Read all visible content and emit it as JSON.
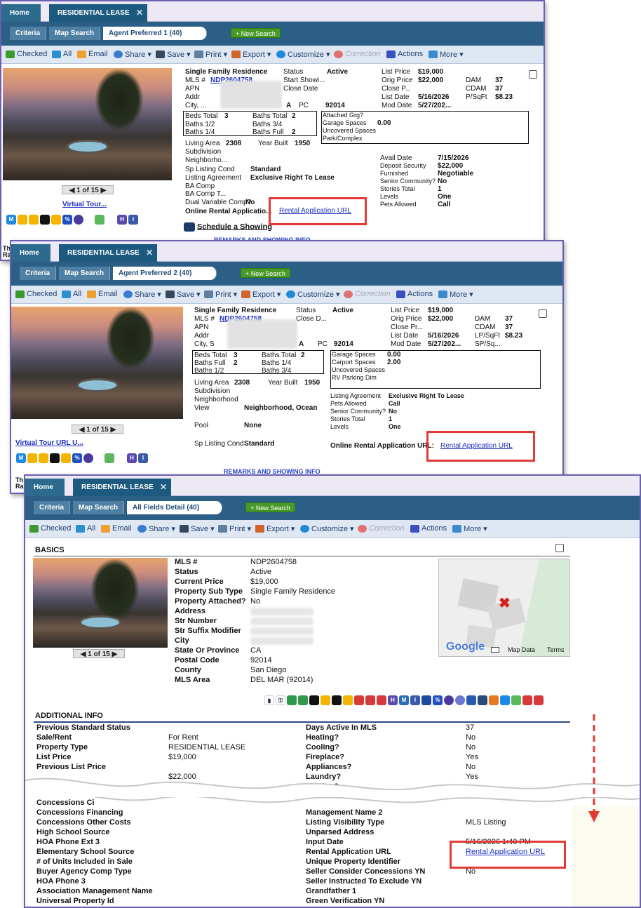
{
  "panel1": {
    "tabs": {
      "home": "Home",
      "active": "RESIDENTIAL LEASE",
      "close": "✕"
    },
    "criteria": {
      "criteria": "Criteria",
      "map": "Map Search",
      "report": "Agent Preferred 1 (40)",
      "new_search": "+ New Search"
    },
    "toolbar": {
      "checked": "Checked",
      "all": "All",
      "email": "Email",
      "share": "Share ▾",
      "save": "Save ▾",
      "print": "Print ▾",
      "export": "Export ▾",
      "customize": "Customize ▾",
      "correction": "Correction",
      "actions": "Actions",
      "more": "More ▾"
    },
    "fields": {
      "type": "Single Family Residence",
      "status_l": "Status",
      "status_v": "Active",
      "list_price_l": "List Price",
      "list_price_v": "$19,000",
      "mls_l": "MLS #",
      "mls_v": "NDP2604758",
      "start_show_l": "Start Showi...",
      "orig_price_l": "Orig Price",
      "orig_price_v": "$22,000",
      "dam_l": "DAM",
      "dam_v": "37",
      "apn_l": "APN",
      "close_date_l": "Close Date",
      "close_p_l": "Close P...",
      "cdam_l": "CDAM",
      "cdam_v": "37",
      "addr_l": "Addr",
      "list_date_l": "List Date",
      "list_date_v": "5/16/2026",
      "psqft_l": "P/SqFt",
      "psqft_v": "$8.23",
      "city_l": "City, ...",
      "city_a": "A",
      "pc_l": "PC",
      "pc_v": "92014",
      "mod_date_l": "Mod Date",
      "mod_date_v": "5/27/202...",
      "beds_total_l": "Beds Total",
      "beds_total_v": "3",
      "baths_total_l": "Baths Total",
      "baths_total_v": "2",
      "baths_half_l": "Baths 1/2",
      "baths_34_l": "Baths 3/4",
      "baths_14_l": "Baths 1/4",
      "baths_full_l": "Baths Full",
      "baths_full_v": "2",
      "att_grg_l": "Attached Grg?",
      "garage_l": "Garage Spaces",
      "garage_v": "0.00",
      "uncov_l": "Uncovered Spaces",
      "park_l": "Park/Complex",
      "living_l": "Living Area",
      "living_v": "2308",
      "year_l": "Year Built",
      "year_v": "1950",
      "subdiv_l": "Subdivision",
      "neigh_l": "Neighborho...",
      "avail_l": "Avail Date",
      "avail_v": "7/15/2026",
      "deposit_l": "Deposit Security",
      "deposit_v": "$22,000",
      "furnished_l": "Furnished",
      "furnished_v": "Negotiable",
      "senior_l": "Senior Community?",
      "senior_v": "No",
      "stories_l": "Stories Total",
      "stories_v": "1",
      "levels_l": "Levels",
      "levels_v": "One",
      "pets_l": "Pets Allowed",
      "pets_v": "Call",
      "sp_cond_l": "Sp Listing Cond",
      "sp_cond_v": "Standard",
      "agreement_l": "Listing Agreement",
      "agreement_v": "Exclusive Right To Lease",
      "ba_comp_l": "BA Comp",
      "ba_comp_t_l": "BA Comp T...",
      "dual_l": "Dual Variable Comp?",
      "dual_v": "No",
      "online_l": "Online Rental Applicatio...",
      "online_v": "Rental Application URL"
    },
    "pager": "◀ 1 of 15 ▶",
    "virtual": "Virtual Tour...",
    "schedule": "Schedule a Showing",
    "remarks": "REMARKS AND SHOWING INFO",
    "cut_text": "Th\nRa"
  },
  "panel2": {
    "tabs": {
      "home": "Home",
      "active": "RESIDENTIAL LEASE",
      "close": "✕"
    },
    "criteria": {
      "criteria": "Criteria",
      "map": "Map Search",
      "report": "Agent Preferred 2 (40)",
      "new_search": "+ New Search"
    },
    "toolbar": {
      "checked": "Checked",
      "all": "All",
      "email": "Email",
      "share": "Share ▾",
      "save": "Save ▾",
      "print": "Print ▾",
      "export": "Export ▾",
      "customize": "Customize ▾",
      "correction": "Correction",
      "actions": "Actions",
      "more": "More ▾"
    },
    "fields": {
      "type": "Single Family Residence",
      "status_l": "Status",
      "status_v": "Active",
      "list_price_l": "List Price",
      "list_price_v": "$19,000",
      "mls_l": "MLS #",
      "mls_v": "NDP2604758",
      "close_d_l": "Close D...",
      "orig_price_l": "Orig Price",
      "orig_price_v": "$22,000",
      "dam_l": "DAM",
      "dam_v": "37",
      "apn_l": "APN",
      "close_pr_l": "Close Pr...",
      "cdam_l": "CDAM",
      "cdam_v": "37",
      "addr_l": "Addr",
      "list_date_l": "List Date",
      "list_date_v": "5/16/2026",
      "lpsqft_l": "LP/SqFt",
      "lpsqft_v": "$8.23",
      "city_l": "City, S",
      "city_a": "A",
      "pc_l": "PC",
      "pc_v": "92014",
      "mod_date_l": "Mod Date",
      "mod_date_v": "5/27/202...",
      "spsq_l": "SP/Sq...",
      "beds_total_l": "Beds Total",
      "beds_total_v": "3",
      "baths_total_l": "Baths Total",
      "baths_total_v": "2",
      "baths_full_l": "Baths Full",
      "baths_full_v": "2",
      "baths_14_l": "Baths 1/4",
      "baths_half_l": "Baths 1/2",
      "baths_34_l": "Baths 3/4",
      "garage_l": "Garage Spaces",
      "garage_v": "0.00",
      "carport_l": "Carport Spaces",
      "carport_v": "2.00",
      "uncov_l": "Uncovered Spaces",
      "rv_l": "RV Parking Dim",
      "living_l": "Living Area",
      "living_v": "2308",
      "year_l": "Year Built",
      "year_v": "1950",
      "subdiv_l": "Subdivision",
      "neigh_l": "Neighborhood",
      "view_l": "View",
      "view_v": "Neighborhood, Ocean",
      "pool_l": "Pool",
      "pool_v": "None",
      "sp_cond_l": "Sp Listing Cond",
      "sp_cond_v": "Standard",
      "agreement_l": "Listing Agreement",
      "agreement_v": "Exclusive Right To Lease",
      "pets_l": "Pets Allowed",
      "pets_v": "Call",
      "senior_l": "Senior Community?",
      "senior_v": "No",
      "stories_l": "Stories Total",
      "stories_v": "1",
      "levels_l": "Levels",
      "levels_v": "One",
      "online_l": "Online Rental Application URL:",
      "online_v": "Rental Application URL"
    },
    "pager": "◀ 1 of 15 ▶",
    "virtual": "Virtual Tour URL U...",
    "remarks": "REMARKS AND SHOWING INFO",
    "cut_text": "Th\nRa"
  },
  "panel3": {
    "tabs": {
      "home": "Home",
      "active": "RESIDENTIAL LEASE",
      "close": "✕"
    },
    "criteria": {
      "criteria": "Criteria",
      "map": "Map Search",
      "report": "All Fields Detail (40)",
      "new_search": "+ New Search"
    },
    "toolbar": {
      "checked": "Checked",
      "all": "All",
      "email": "Email",
      "share": "Share ▾",
      "save": "Save ▾",
      "print": "Print ▾",
      "export": "Export ▾",
      "customize": "Customize ▾",
      "correction": "Correction",
      "actions": "Actions",
      "more": "More ▾"
    },
    "basics_title": "BASICS",
    "basics": [
      {
        "k": "MLS #",
        "v": "NDP2604758"
      },
      {
        "k": "Status",
        "v": "Active"
      },
      {
        "k": "Current Price",
        "v": "$19,000"
      },
      {
        "k": "Property Sub Type",
        "v": "Single Family Residence"
      },
      {
        "k": "Property Attached?",
        "v": "No"
      },
      {
        "k": "Address",
        "v": ""
      },
      {
        "k": "Str Number",
        "v": ""
      },
      {
        "k": "Str Suffix Modifier",
        "v": ""
      },
      {
        "k": "City",
        "v": ""
      },
      {
        "k": "State Or Province",
        "v": "CA"
      },
      {
        "k": "Postal Code",
        "v": "92014"
      },
      {
        "k": "County",
        "v": "San Diego"
      },
      {
        "k": "MLS Area",
        "v": "DEL MAR (92014)"
      }
    ],
    "pager": "◀ 1 of 15 ▶",
    "map": {
      "google": "Google",
      "map_data": "Map Data",
      "terms": "Terms"
    },
    "additional_title": "ADDITIONAL INFO",
    "add_left": [
      {
        "k": "Previous Standard Status",
        "v": ""
      },
      {
        "k": "Sale/Rent",
        "v": "For Rent"
      },
      {
        "k": "Property Type",
        "v": "RESIDENTIAL LEASE"
      },
      {
        "k": "List Price",
        "v": "$19,000"
      },
      {
        "k": "Previous List Price",
        "v": ""
      },
      {
        "k": "",
        "v": "$22,000"
      }
    ],
    "add_right": [
      {
        "k": "Days Active In MLS",
        "v": "37"
      },
      {
        "k": "Heating?",
        "v": "No"
      },
      {
        "k": "Cooling?",
        "v": "No"
      },
      {
        "k": "Fireplace?",
        "v": "Yes"
      },
      {
        "k": "Appliances?",
        "v": "No"
      },
      {
        "k": "Laundry?",
        "v": "Yes"
      },
      {
        "k": "Parking?",
        "v": ""
      }
    ],
    "low_left": [
      "Concessions Ci",
      "Concessions Financing",
      "Concessions Other Costs",
      "High School Source",
      "HOA Phone Ext 3",
      "Elementary School Source",
      "# of Units Included in Sale",
      "Buyer Agency Comp Type",
      "HOA Phone 3",
      "Association Management Name",
      "Universal Property Id"
    ],
    "low_right": [
      {
        "k": "Management Name 2",
        "v": ""
      },
      {
        "k": "Listing Visibility Type",
        "v": "MLS Listing"
      },
      {
        "k": "Unparsed Address",
        "v": ""
      },
      {
        "k": "Input Date",
        "v": "5/16/2026 1:40 PM"
      },
      {
        "k": "Rental Application URL",
        "v": "Rental Application URL"
      },
      {
        "k": "Unique Property Identifier",
        "v": ""
      },
      {
        "k": "Seller Consider Concessions YN",
        "v": "No"
      },
      {
        "k": "Seller Instructed To Exclude YN",
        "v": ""
      },
      {
        "k": "Grandfather 1",
        "v": ""
      },
      {
        "k": "Green Verification YN",
        "v": ""
      }
    ]
  }
}
